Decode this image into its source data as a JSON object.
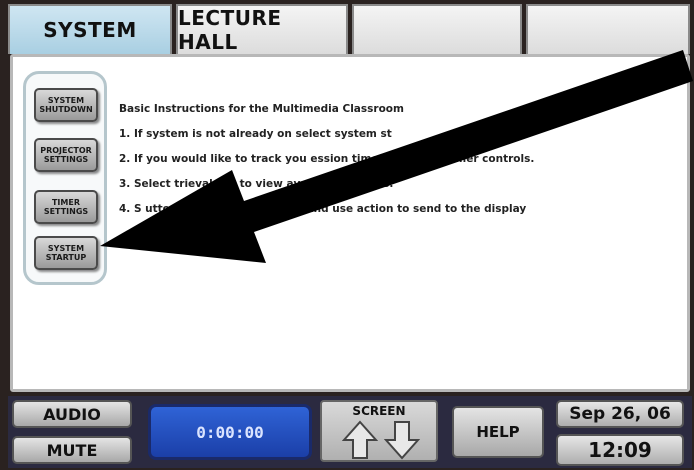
{
  "tabs": [
    {
      "label": "SYSTEM"
    },
    {
      "label": "LECTURE HALL"
    },
    {
      "label": ""
    },
    {
      "label": ""
    }
  ],
  "sidebar": {
    "buttons": [
      {
        "label": "SYSTEM\nSHUTDOWN"
      },
      {
        "label": "PROJECTOR\nSETTINGS"
      },
      {
        "label": "TIMER\nSETTINGS"
      },
      {
        "label": "SYSTEM\nSTARTUP"
      }
    ]
  },
  "instructions": {
    "heading": "Basic Instructions for the Multimedia Classroom",
    "lines": [
      "1. If system is not already on select system st",
      "2. If you would like to track you                    ession timer using the timer controls.",
      "3. Select                     trieval tab to view available sources.",
      "4. S                      utton to preview the sorce and use action to send to the display"
    ]
  },
  "bottom": {
    "audio_label": "AUDIO",
    "mute_label": "MUTE",
    "timer_value": "0:00:00",
    "screen_label": "SCREEN",
    "help_label": "HELP",
    "date": "Sep 26, 06",
    "time": "12:09"
  }
}
